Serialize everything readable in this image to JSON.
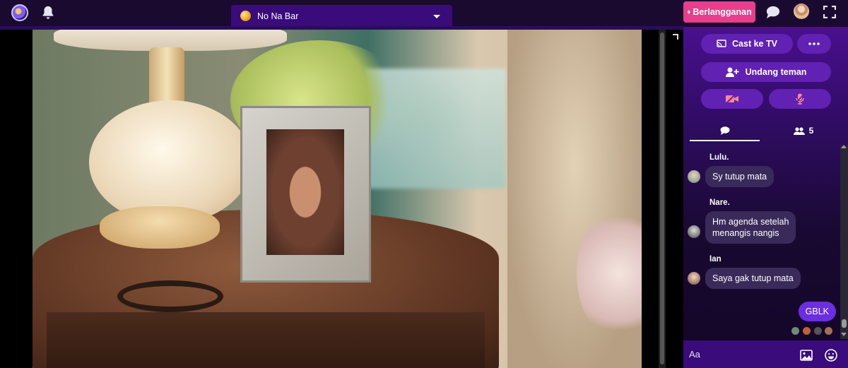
{
  "header": {
    "room_name": "No Na Bar",
    "subscribe_label": "Berlangganan",
    "accent_color": "#e83e8c"
  },
  "sidebar": {
    "cast_label": "Cast ke TV",
    "invite_label": "Undang teman",
    "users_count": "5"
  },
  "chat": {
    "messages": [
      {
        "sender": "Lulu.",
        "text": "Sy tutup mata"
      },
      {
        "sender": "Nare.",
        "text_line1": "Hm agenda setelah",
        "text_line2": "menangis nangis"
      },
      {
        "sender": "Ian",
        "text": "Saya gak tutup mata"
      }
    ],
    "own_message": "GBLK",
    "composer_placeholder": "Aa"
  },
  "theme": {
    "sidebar_purple": "#4a0f8e",
    "button_purple": "#6121b3",
    "own_bubble": "#6c2ee0"
  }
}
